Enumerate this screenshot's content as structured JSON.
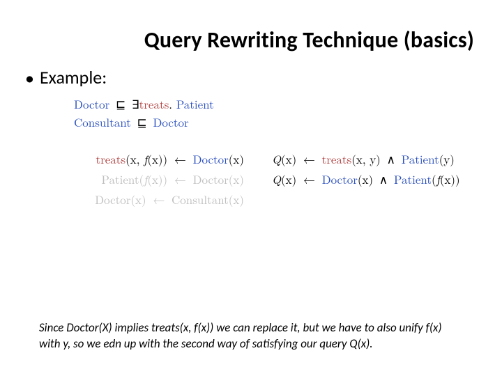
{
  "title": "Query Rewriting Technique (basics)",
  "bullet_label": "Example:",
  "axioms": {
    "a1": {
      "lhs": "Doctor",
      "sub": "⊑",
      "exists": "∃",
      "role": "treats",
      "dot": ".",
      "rhs": "Patient"
    },
    "a2": {
      "lhs": "Consultant",
      "sub": "⊑",
      "rhs": "Doctor"
    }
  },
  "rules": {
    "r1": {
      "head_role": "treats",
      "head_args": "(x, ",
      "head_f": "f",
      "head_args2": "(x))",
      "arrow": "←",
      "body": "Doctor",
      "body_args": "(x)"
    },
    "r2": {
      "head": "Patient",
      "head_args": "(",
      "head_f": "f",
      "head_args2": "(x))",
      "arrow": "←",
      "body": "Doctor",
      "body_args": "(x)"
    },
    "r3": {
      "head": "Doctor",
      "head_args": "(x)",
      "arrow": "←",
      "body": "Consultant",
      "body_args": "(x)"
    }
  },
  "queries": {
    "q1": {
      "q": "Q",
      "qargs": "(x)",
      "arrow": "←",
      "role": "treats",
      "roleargs": "(x, y)",
      "and": "∧",
      "concept": "Patient",
      "cargs": "(y)"
    },
    "q2": {
      "q": "Q",
      "qargs": "(x)",
      "arrow": "←",
      "concept": "Doctor",
      "cargs1": "(x)",
      "and": "∧",
      "concept2": "Patient",
      "cargs2": "(",
      "f": "f",
      "cargs3": "(x))"
    }
  },
  "footnote": "Since Doctor(X) implies treats(x, f(x)) we can replace it, but we have to also unify f(x) with y, so we edn up with the second way of satisfying our query Q(x)."
}
